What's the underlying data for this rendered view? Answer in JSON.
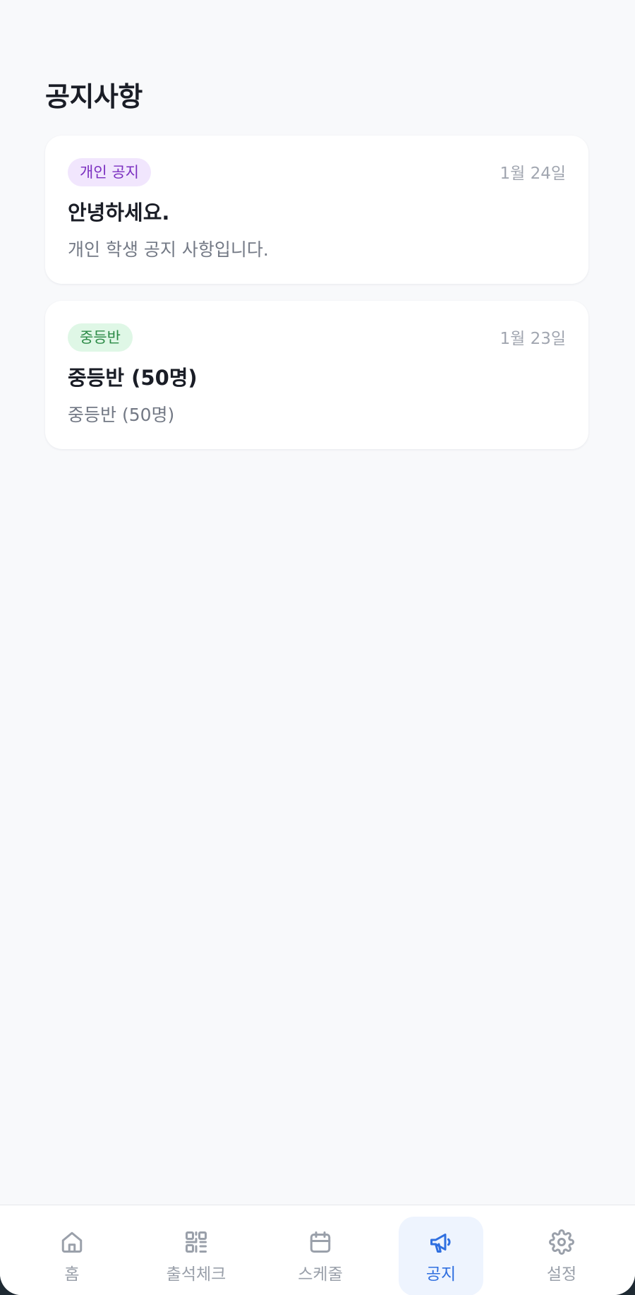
{
  "page": {
    "title": "공지사항"
  },
  "notices": [
    {
      "badge": "개인 공지",
      "date": "1월 24일",
      "title": "안녕하세요.",
      "body": "개인 학생 공지 사항입니다."
    },
    {
      "badge": "중등반",
      "date": "1월 23일",
      "title": "중등반 (50명)",
      "body": "중등반 (50명)"
    }
  ],
  "nav": {
    "active": "공지",
    "items": [
      {
        "label": "홈",
        "icon": "home-icon"
      },
      {
        "label": "출석체크",
        "icon": "qr-code-icon"
      },
      {
        "label": "스케줄",
        "icon": "calendar-icon"
      },
      {
        "label": "공지",
        "icon": "megaphone-icon"
      },
      {
        "label": "설정",
        "icon": "gear-icon"
      }
    ]
  },
  "colors": {
    "accent": "#2f6fe0",
    "personal_badge_bg": "#f1e6fd",
    "personal_badge_text": "#7b2fc0",
    "class_badge_bg": "#dff7e6",
    "class_badge_text": "#2b8a46"
  }
}
